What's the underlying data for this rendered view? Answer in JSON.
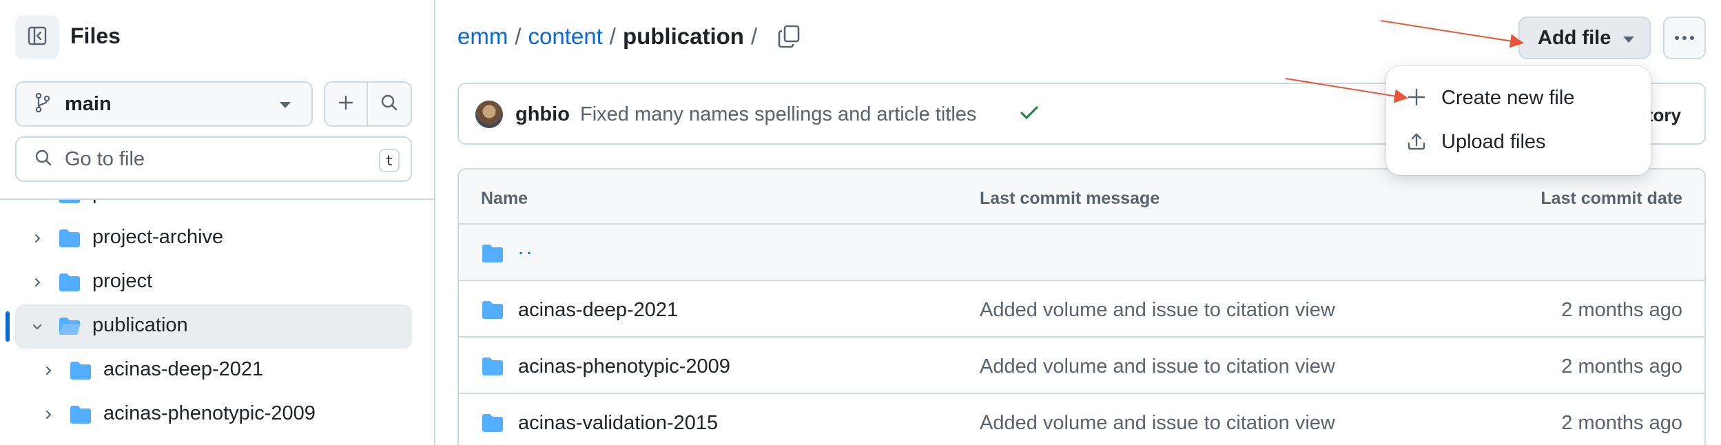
{
  "sidebar": {
    "title": "Files",
    "branch": "main",
    "goto_placeholder": "Go to file",
    "goto_shortcut": "t",
    "tree": [
      {
        "label": "post",
        "level": 0,
        "expanded": false,
        "selected": false
      },
      {
        "label": "project-archive",
        "level": 0,
        "expanded": false,
        "selected": false
      },
      {
        "label": "project",
        "level": 0,
        "expanded": false,
        "selected": false
      },
      {
        "label": "publication",
        "level": 0,
        "expanded": true,
        "selected": true
      },
      {
        "label": "acinas-deep-2021",
        "level": 1,
        "expanded": false,
        "selected": false
      },
      {
        "label": "acinas-phenotypic-2009",
        "level": 1,
        "expanded": false,
        "selected": false
      }
    ]
  },
  "breadcrumb": {
    "root": "emm",
    "sep": "/",
    "folder": "content",
    "current": "publication"
  },
  "toolbar": {
    "add_file_label": "Add file",
    "more_icon": "kebab-horizontal-icon"
  },
  "dropdown": {
    "items": [
      {
        "label": "Create new file",
        "icon": "plus-icon"
      },
      {
        "label": "Upload files",
        "icon": "upload-icon"
      }
    ]
  },
  "latest_commit": {
    "author": "ghbio",
    "message": "Fixed many names spellings and article titles",
    "status": "success",
    "history_fragment": "tory"
  },
  "table": {
    "headers": {
      "name": "Name",
      "message": "Last commit message",
      "date": "Last commit date"
    },
    "parent_dir": "..",
    "rows": [
      {
        "name": "acinas-deep-2021",
        "message": "Added volume and issue to citation view",
        "date": "2 months ago"
      },
      {
        "name": "acinas-phenotypic-2009",
        "message": "Added volume and issue to citation view",
        "date": "2 months ago"
      },
      {
        "name": "acinas-validation-2015",
        "message": "Added volume and issue to citation view",
        "date": "2 months ago"
      }
    ]
  },
  "colors": {
    "link": "#0969da",
    "folder": "#54aeff",
    "annotation_arrow": "#e8553a",
    "success": "#1a7f37"
  }
}
